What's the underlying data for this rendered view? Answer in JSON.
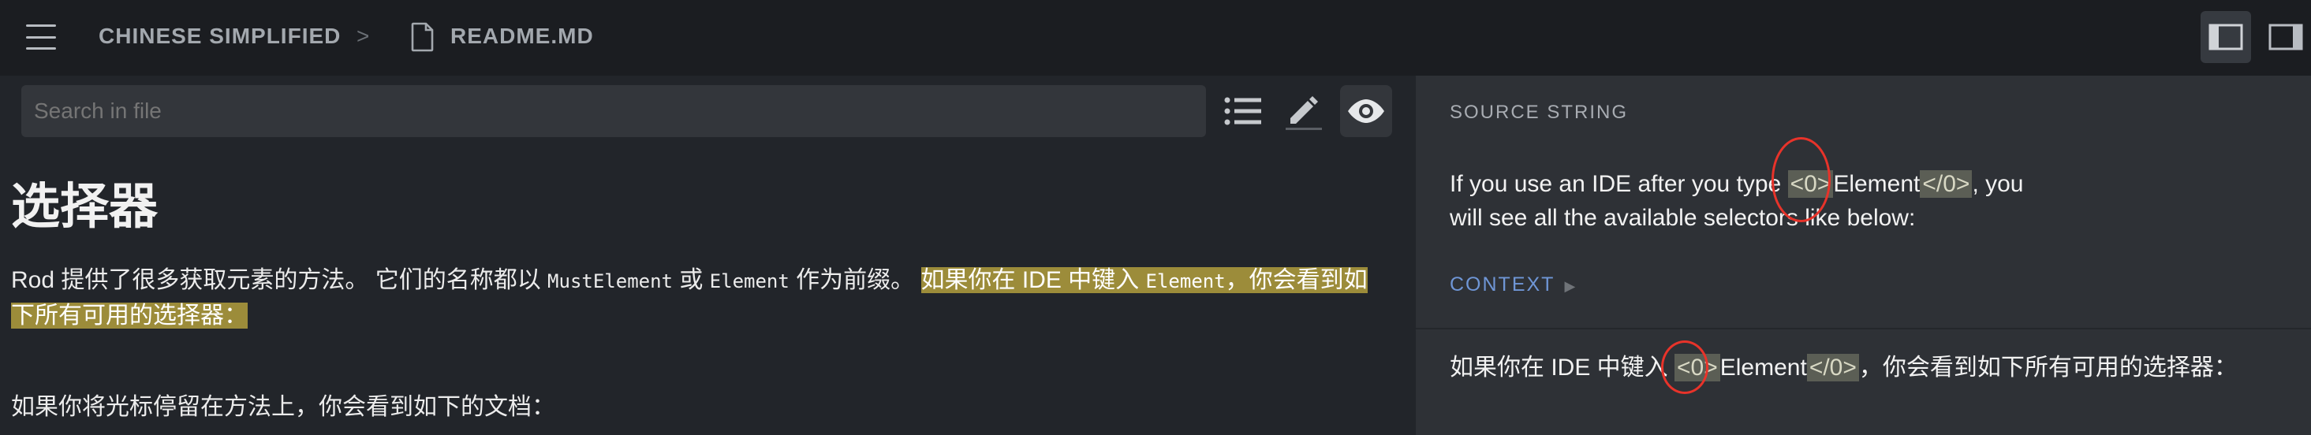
{
  "header": {
    "language": "CHINESE SIMPLIFIED",
    "separator": ">",
    "file_name": "README.MD",
    "icons": [
      "menu-icon",
      "file-icon",
      "sidebar-left-layout-icon",
      "sidebar-right-layout-icon"
    ]
  },
  "search": {
    "placeholder": "Search in file"
  },
  "toolbar": {
    "icons": [
      "list-icon",
      "pencil-icon",
      "eye-icon"
    ]
  },
  "document": {
    "heading": "选择器",
    "para1_a": "Rod 提供了很多获取元素的方法。 它们的名称都以 ",
    "para1_code1": "MustElement",
    "para1_b": " 或 ",
    "para1_code2": "Element",
    "para1_c": " 作为前缀。 ",
    "para1_hl_a": "如果你在 IDE 中键入 ",
    "para1_hl_code": "Element",
    "para1_hl_b": "，你会看到如下所有可用的选择器：",
    "para2": "如果你将光标停留在方法上，你会看到如下的文档："
  },
  "source": {
    "label": "SOURCE STRING",
    "text_a": "If you use an IDE after you type ",
    "tag_open": "<0>",
    "text_b": "Element",
    "tag_close": "</0>",
    "text_c": ", you will see all the available selectors like below:",
    "context_label": "CONTEXT",
    "context_caret": "▶"
  },
  "translation": {
    "text_a": "如果你在 IDE 中键入 ",
    "tag_open": "<0>",
    "text_b": "Element",
    "tag_close": "</0>",
    "text_c": "，你会看到如下所有可用的选择器："
  },
  "colors": {
    "highlight": "#9c8c3a",
    "annotation_circle": "#e8332a",
    "context_link": "#6f96d6"
  }
}
